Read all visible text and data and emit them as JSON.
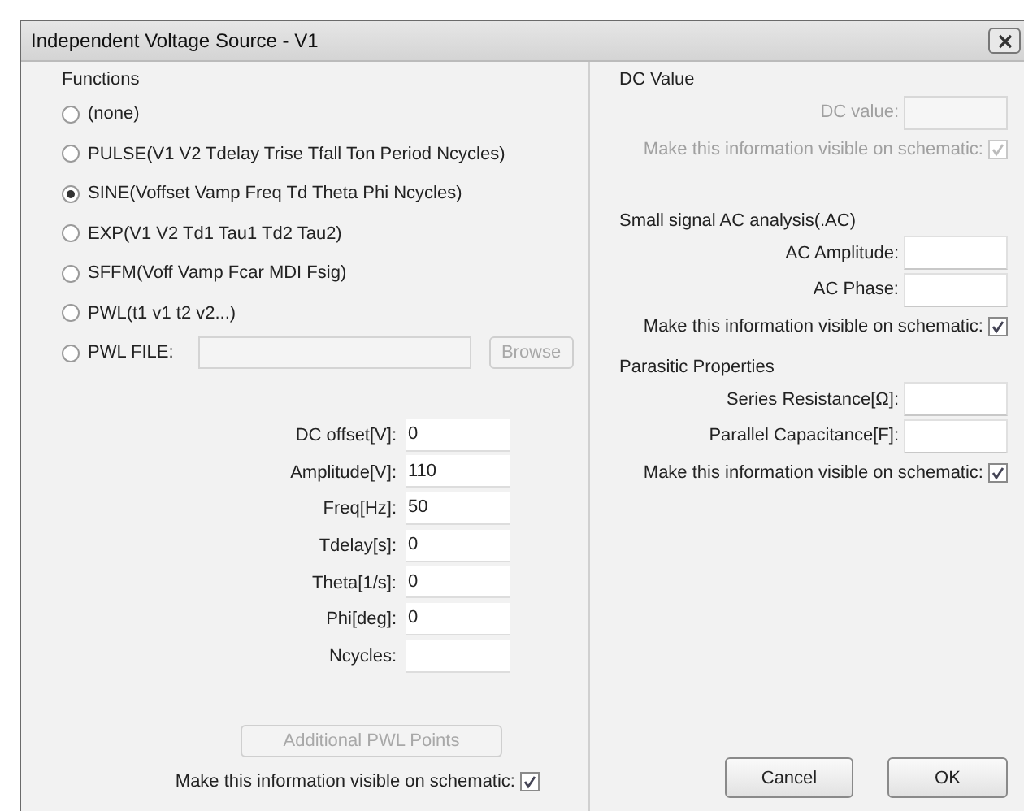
{
  "window": {
    "title": "Independent Voltage Source - V1"
  },
  "functions": {
    "heading": "Functions",
    "options": [
      {
        "label": "(none)",
        "selected": false
      },
      {
        "label": "PULSE(V1 V2 Tdelay Trise Tfall Ton Period Ncycles)",
        "selected": false
      },
      {
        "label": "SINE(Voffset Vamp Freq Td Theta Phi Ncycles)",
        "selected": true
      },
      {
        "label": "EXP(V1 V2 Td1 Tau1 Td2 Tau2)",
        "selected": false
      },
      {
        "label": "SFFM(Voff Vamp Fcar MDI Fsig)",
        "selected": false
      },
      {
        "label": "PWL(t1 v1 t2 v2...)",
        "selected": false
      },
      {
        "label": "PWL FILE:",
        "selected": false,
        "kind": "file"
      }
    ],
    "file_field": {
      "disabled": true
    },
    "browse_button": {
      "label": "Browse",
      "disabled": true
    }
  },
  "parameters": [
    {
      "label": "DC offset[V]:",
      "value": "0"
    },
    {
      "label": "Amplitude[V]:",
      "value": "110"
    },
    {
      "label": "Freq[Hz]:",
      "value": "50"
    },
    {
      "label": "Tdelay[s]:",
      "value": "0"
    },
    {
      "label": "Theta[1/s]:",
      "value": "0"
    },
    {
      "label": "Phi[deg]:",
      "value": "0"
    },
    {
      "label": "Ncycles:"
    }
  ],
  "pwl_points_button": {
    "label": "Additional PWL Points",
    "disabled": true
  },
  "left_visibility": {
    "label": "Make this information visible on schematic:",
    "checked": true,
    "disabled": false
  },
  "dc_value": {
    "heading": "DC Value",
    "field": {
      "label": "DC value:",
      "disabled": true
    },
    "visibility": {
      "label": "Make this information visible on schematic:",
      "checked": true,
      "disabled": true
    }
  },
  "ac_analysis": {
    "heading": "Small signal AC analysis(.AC)",
    "fields": [
      {
        "label": "AC Amplitude:"
      },
      {
        "label": "AC Phase:"
      }
    ],
    "visibility": {
      "label": "Make this information visible on schematic:",
      "checked": true,
      "disabled": false
    }
  },
  "parasitic": {
    "heading": "Parasitic Properties",
    "fields": [
      {
        "label": "Series Resistance[Ω]:"
      },
      {
        "label": "Parallel Capacitance[F]:"
      }
    ],
    "visibility": {
      "label": "Make this information visible on schematic:",
      "checked": true,
      "disabled": false
    }
  },
  "buttons": [
    {
      "label": "Cancel"
    },
    {
      "label": "OK"
    }
  ]
}
